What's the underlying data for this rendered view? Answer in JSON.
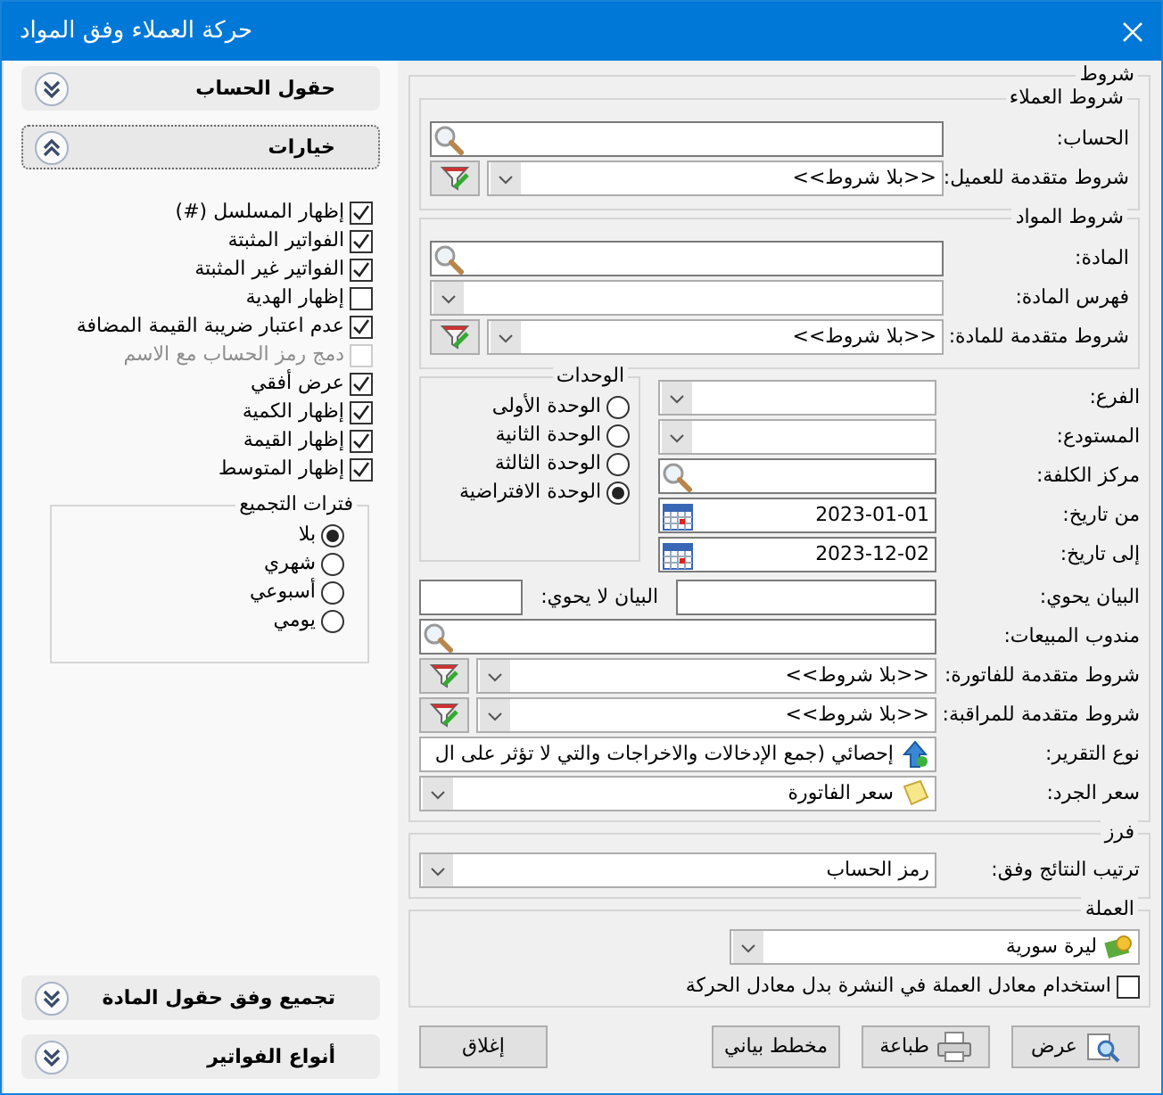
{
  "window": {
    "title": "حركة العملاء وفق المواد"
  },
  "conditions": {
    "title": "شروط",
    "customer_group": {
      "title": "شروط العملاء",
      "rows": [
        {
          "kind": "search",
          "label": "الحساب:"
        },
        {
          "kind": "filter_combo",
          "label": "شروط متقدمة للعميل:",
          "value": "<<بلا شروط>>"
        }
      ]
    },
    "material_group": {
      "title": "شروط المواد",
      "rows": [
        {
          "kind": "search",
          "label": "المادة:"
        },
        {
          "kind": "combo",
          "label": "فهرس المادة:"
        },
        {
          "kind": "filter_combo",
          "label": "شروط متقدمة للمادة:",
          "value": "<<بلا شروط>>"
        }
      ]
    },
    "short_rows": [
      {
        "kind": "combo",
        "label": "الفرع:"
      },
      {
        "kind": "combo",
        "label": "المستودع:"
      },
      {
        "kind": "search",
        "label": "مركز الكلفة:"
      },
      {
        "kind": "date",
        "label": "من تاريخ:",
        "value": "2023-01-01"
      },
      {
        "kind": "date",
        "label": "إلى تاريخ:",
        "value": "2023-12-02"
      }
    ],
    "units": {
      "title": "الوحدات",
      "options": [
        {
          "label": "الوحدة الأولى",
          "selected": false
        },
        {
          "label": "الوحدة الثانية",
          "selected": false
        },
        {
          "label": "الوحدة الثالثة",
          "selected": false
        },
        {
          "label": "الوحدة الافتراضية",
          "selected": true
        }
      ]
    },
    "rows": [
      {
        "kind": "text_pair",
        "label": "البيان يحوي:",
        "label_2": "البيان لا يحوي:"
      },
      {
        "kind": "search",
        "label": "مندوب المبيعات:"
      },
      {
        "kind": "filter_combo",
        "label": "شروط متقدمة للفاتورة:",
        "value": "<<بلا شروط>>"
      },
      {
        "kind": "filter_combo",
        "label": "شروط متقدمة للمراقبة:",
        "value": "<<بلا شروط>>"
      },
      {
        "kind": "report_combo",
        "label": "نوع التقرير:",
        "value": "إحصائي (جمع الإدخالات والاخراجات والتي لا تؤثر على ال"
      },
      {
        "kind": "price_combo",
        "label": "سعر الجرد:",
        "value": "سعر الفاتورة"
      }
    ]
  },
  "sort": {
    "title": "فرز",
    "rows": [
      {
        "kind": "combo",
        "label": "ترتيب النتائج وفق:",
        "value": "رمز الحساب"
      }
    ]
  },
  "currency": {
    "title": "العملة",
    "combo": {
      "value": "ليرة سورية"
    },
    "checkbox": {
      "label": "استخدام معادل العملة في النشرة بدل معادل الحركة",
      "checked": false
    }
  },
  "buttons": [
    {
      "kind": "view",
      "label": "عرض"
    },
    {
      "kind": "print",
      "label": "طباعة"
    },
    {
      "kind": "chart",
      "label": "مخطط بياني"
    },
    {
      "kind": "close",
      "label": "إغلاق"
    }
  ],
  "sidebar": {
    "panels": [
      {
        "title": "حقول الحساب",
        "expanded": false
      },
      {
        "title": "خيارات",
        "expanded": true,
        "checkboxes": [
          {
            "label": "إظهار المسلسل (#)",
            "checked": true,
            "disabled": false
          },
          {
            "label": "الفواتير المثبتة",
            "checked": true,
            "disabled": false
          },
          {
            "label": "الفواتير غير المثبتة",
            "checked": true,
            "disabled": false
          },
          {
            "label": "إظهار الهدية",
            "checked": false,
            "disabled": false
          },
          {
            "label": "عدم اعتبار ضريبة القيمة المضافة",
            "checked": true,
            "disabled": false
          },
          {
            "label": "دمج رمز الحساب مع الاسم",
            "checked": false,
            "disabled": true
          },
          {
            "label": "عرض أفقي",
            "checked": true,
            "disabled": false
          },
          {
            "label": "إظهار الكمية",
            "checked": true,
            "disabled": false
          },
          {
            "label": "إظهار القيمة",
            "checked": true,
            "disabled": false
          },
          {
            "label": "إظهار المتوسط",
            "checked": true,
            "disabled": false
          }
        ],
        "periods": {
          "title": "فترات التجميع",
          "options": [
            {
              "label": "بلا",
              "selected": true
            },
            {
              "label": "شهري",
              "selected": false
            },
            {
              "label": "أسبوعي",
              "selected": false
            },
            {
              "label": "يومي",
              "selected": false
            }
          ]
        }
      },
      {
        "title": "تجميع وفق حقول المادة",
        "expanded": false
      },
      {
        "title": "أنواع الفواتير",
        "expanded": false
      }
    ]
  }
}
